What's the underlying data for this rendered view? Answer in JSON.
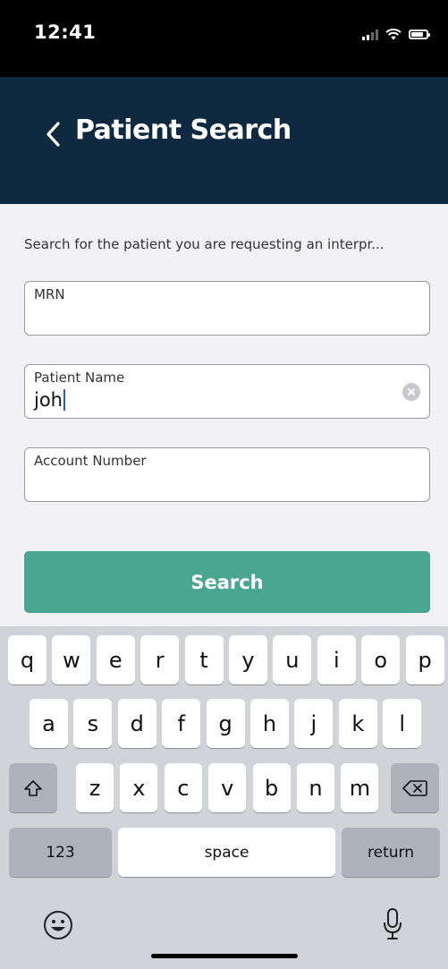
{
  "status_bar": {
    "time": "12:41",
    "battery_level": 0.8
  },
  "nav": {
    "title": "Patient Search",
    "back_icon": "chevron-left-icon"
  },
  "form": {
    "instruction": "Search for the patient you are requesting an interpr...",
    "fields": [
      {
        "label": "MRN",
        "value": ""
      },
      {
        "label": "Patient Name",
        "value": "joh"
      },
      {
        "label": "Account Number",
        "value": ""
      }
    ],
    "search_label": "Search"
  },
  "keyboard": {
    "row1": [
      "q",
      "w",
      "e",
      "r",
      "t",
      "y",
      "u",
      "i",
      "o",
      "p"
    ],
    "row2": [
      "a",
      "s",
      "d",
      "f",
      "g",
      "h",
      "j",
      "k",
      "l"
    ],
    "row3": [
      "z",
      "x",
      "c",
      "v",
      "b",
      "n",
      "m"
    ],
    "numbers_label": "123",
    "space_label": "space",
    "return_label": "return"
  },
  "colors": {
    "nav": "#0f2940",
    "accent": "#4aa591",
    "caret": "#2a5bd7"
  }
}
